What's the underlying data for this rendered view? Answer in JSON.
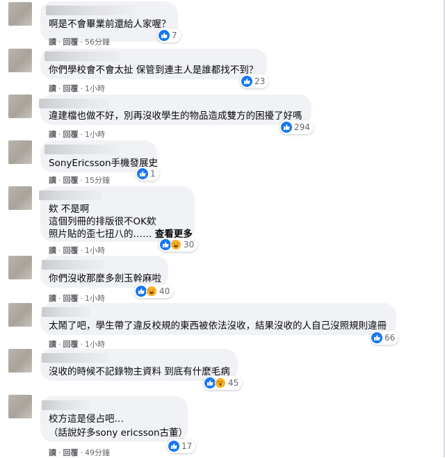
{
  "actions": {
    "read": "讀",
    "reply": "回覆"
  },
  "comments": [
    {
      "lines": [
        "啊是不會畢業前還給人家喔？"
      ],
      "count": "7",
      "reactions": [
        "like"
      ],
      "time": "56分鐘"
    },
    {
      "lines": [
        "你們學校會不會太扯 保管到連主人是誰都找不到？"
      ],
      "count": "23",
      "reactions": [
        "like"
      ],
      "time": "1小時"
    },
    {
      "lines": [
        "違建檔也做不好，別再沒收學生的物品造成雙方的困擾了好嗎"
      ],
      "count": "294",
      "reactions": [
        "like"
      ],
      "time": "1小時"
    },
    {
      "lines": [
        "SonyEricsson手機發展史"
      ],
      "count": "1",
      "reactions": [
        "like"
      ],
      "time": "15分鐘"
    },
    {
      "lines": [
        "欸 不是啊",
        "這個列冊的排版很不OK欸",
        "照片貼的歪七扭八的……"
      ],
      "see_more": "查看更多",
      "count": "30",
      "reactions": [
        "like",
        "haha"
      ],
      "time": "1小時"
    },
    {
      "lines": [
        "你們沒收那麼多劍玉幹麻啦"
      ],
      "count": "40",
      "reactions": [
        "like",
        "haha"
      ],
      "time": "1小時"
    },
    {
      "lines": [
        "太鬧了吧，學生帶了違反校規的東西被依法沒收，結果沒收的人自己沒照規則違冊"
      ],
      "count": "66",
      "reactions": [
        "like"
      ],
      "time": "1小時"
    },
    {
      "lines": [
        "沒收的時候不記錄物主資料 到底有什麼毛病"
      ],
      "count": "45",
      "reactions": [
        "like",
        "wow"
      ],
      "time": "1小時"
    },
    {
      "lines": [
        "校方這是侵占吧…",
        "（話說好多sony ericsson古董）"
      ],
      "count": "17",
      "reactions": [
        "like"
      ],
      "time": "49分鐘"
    }
  ]
}
